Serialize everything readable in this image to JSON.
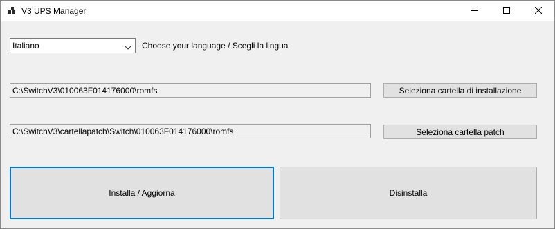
{
  "window": {
    "title": "V3 UPS Manager",
    "icons": {
      "app": "app-icon",
      "minimize": "minimize-icon",
      "maximize": "maximize-icon",
      "close": "close-icon"
    }
  },
  "language": {
    "selected": "Italiano",
    "label": "Choose your language / Scegli la lingua"
  },
  "install_folder": {
    "path": "C:\\SwitchV3\\010063F014176000\\romfs",
    "button_label": "Seleziona cartella di installazione"
  },
  "patch_folder": {
    "path": "C:\\SwitchV3\\cartellapatch\\Switch\\010063F014176000\\romfs",
    "button_label": "Seleziona cartella patch"
  },
  "actions": {
    "install_label": "Installa / Aggiorna",
    "uninstall_label": "Disinstalla"
  },
  "colors": {
    "focus": "#0078d7",
    "button": "#e1e1e1",
    "background": "#f0f0f0"
  }
}
